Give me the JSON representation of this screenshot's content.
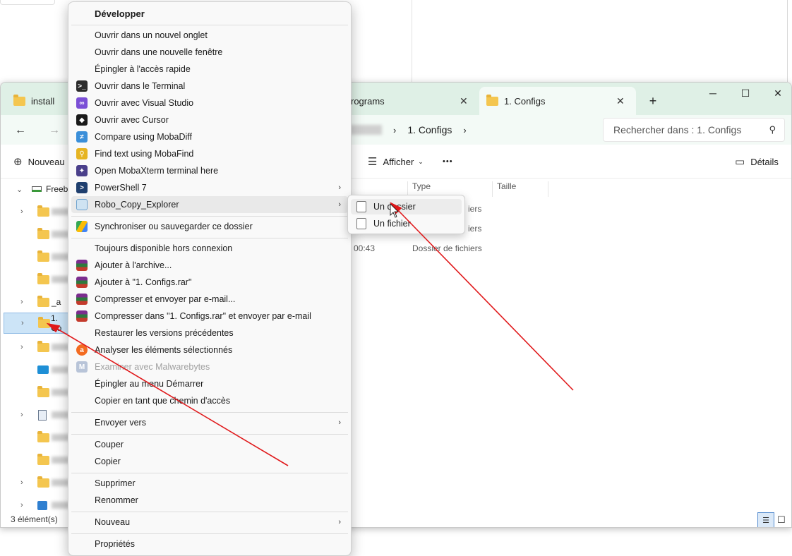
{
  "tabs": [
    {
      "label": "install"
    },
    {
      "label": "rograms"
    },
    {
      "label": "1. Configs"
    }
  ],
  "window_controls": {
    "minimize": "─",
    "maximize": "☐",
    "close": "✕"
  },
  "address": {
    "current": "1. Configs",
    "search_placeholder": "Rechercher dans : 1. Configs"
  },
  "toolbar": {
    "new_label": "Nouveau",
    "view_label": "Afficher",
    "more_label": "•••",
    "details_label": "Détails"
  },
  "tree": [
    {
      "label": "Freebo"
    },
    {
      "label": "_a"
    },
    {
      "label": "1. Co"
    }
  ],
  "columns": {
    "type": "Type",
    "size": "Taille"
  },
  "rows": [
    {
      "date_fragment": "",
      "type_fragment": "iers"
    },
    {
      "date_fragment": "",
      "type_fragment": "iers"
    },
    {
      "date_fragment": "00:43",
      "type_fragment": "Dossier de fichiers"
    }
  ],
  "status": {
    "count": "3 élément(s)"
  },
  "context_menu": {
    "items": [
      {
        "label": "Développer",
        "icon": "none"
      },
      {
        "label": "Ouvrir dans un nouvel onglet",
        "icon": "none"
      },
      {
        "label": "Ouvrir dans une nouvelle fenêtre",
        "icon": "none"
      },
      {
        "label": "Épingler à l'accès rapide",
        "icon": "none"
      },
      {
        "label": "Ouvrir dans le Terminal",
        "icon": "terminal-icon"
      },
      {
        "label": "Ouvrir avec Visual Studio",
        "icon": "visual-studio-icon"
      },
      {
        "label": "Ouvrir avec Cursor",
        "icon": "cursor-icon"
      },
      {
        "label": "Compare using MobaDiff",
        "icon": "mobadiff-icon"
      },
      {
        "label": "Find text using MobaFind",
        "icon": "mobafind-icon"
      },
      {
        "label": "Open MobaXterm terminal here",
        "icon": "mobaxterm-icon"
      },
      {
        "label": "PowerShell 7",
        "icon": "powershell-icon"
      },
      {
        "label": "Robo_Copy_Explorer",
        "icon": "robocopy-icon"
      },
      {
        "label": "Synchroniser ou sauvegarder ce dossier",
        "icon": "google-drive-icon"
      },
      {
        "label": "Toujours disponible hors connexion",
        "icon": "none"
      },
      {
        "label": "Ajouter à l'archive...",
        "icon": "winrar-icon"
      },
      {
        "label": "Ajouter à \"1. Configs.rar\"",
        "icon": "winrar-icon"
      },
      {
        "label": "Compresser et envoyer par e-mail...",
        "icon": "winrar-icon"
      },
      {
        "label": "Compresser dans \"1. Configs.rar\" et envoyer par e-mail",
        "icon": "winrar-icon"
      },
      {
        "label": "Restaurer les versions précédentes",
        "icon": "none"
      },
      {
        "label": "Analyser les éléments sélectionnés",
        "icon": "avast-icon"
      },
      {
        "label": "Examiner avec Malwarebytes",
        "icon": "malwarebytes-icon"
      },
      {
        "label": "Épingler au menu Démarrer",
        "icon": "none"
      },
      {
        "label": "Copier en tant que chemin d'accès",
        "icon": "none"
      },
      {
        "label": "Envoyer vers",
        "icon": "none"
      },
      {
        "label": "Couper",
        "icon": "none"
      },
      {
        "label": "Copier",
        "icon": "none"
      },
      {
        "label": "Supprimer",
        "icon": "none"
      },
      {
        "label": "Renommer",
        "icon": "none"
      },
      {
        "label": "Nouveau",
        "icon": "none"
      },
      {
        "label": "Propriétés",
        "icon": "none"
      }
    ]
  },
  "submenu": {
    "items": [
      {
        "label": "Un dossier"
      },
      {
        "label": "Un fichier"
      }
    ]
  },
  "colors": {
    "tabbar_bg": "#dff0e6",
    "address_bg": "#f3faf6",
    "annotation_arrow": "#e0191b",
    "selection": "#cce4f7"
  }
}
